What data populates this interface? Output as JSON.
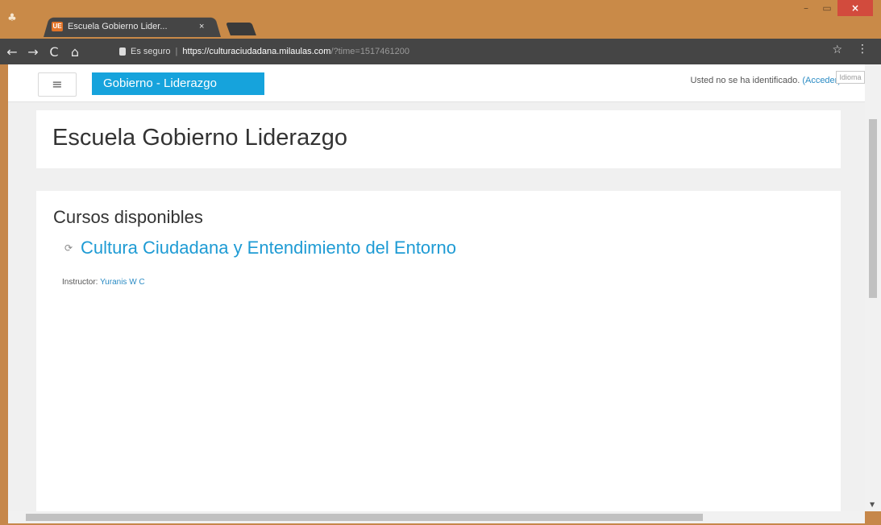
{
  "browser": {
    "tab_title": "Escuela Gobierno Lider...",
    "tab_favicon": "UE",
    "tab_close": "×",
    "security_label": "Es seguro",
    "separator": "|",
    "url_host": "https://culturaciudadana.milaulas.com",
    "url_path": "/?time=1517461200",
    "window_minimize": "–",
    "window_maximize": "▭",
    "window_close": "×"
  },
  "nav": {
    "back": "←",
    "forward": "→",
    "reload": "C",
    "home": "⌂",
    "star": "☆",
    "menu": "⋮"
  },
  "navbar": {
    "hamburger": "≡",
    "brand": "Gobierno - Liderazgo",
    "login_prefix": "Usted no se ha identificado. ",
    "login_link": "(Acceder)",
    "lang": "Idioma"
  },
  "page": {
    "site_title": "Escuela Gobierno Liderazgo",
    "section_title": "Cursos disponibles",
    "course_title": "Cultura Ciudadana y Entendimiento del Entorno",
    "instructor_label": "Instructor: ",
    "instructor_name": "Yuranis W C"
  }
}
